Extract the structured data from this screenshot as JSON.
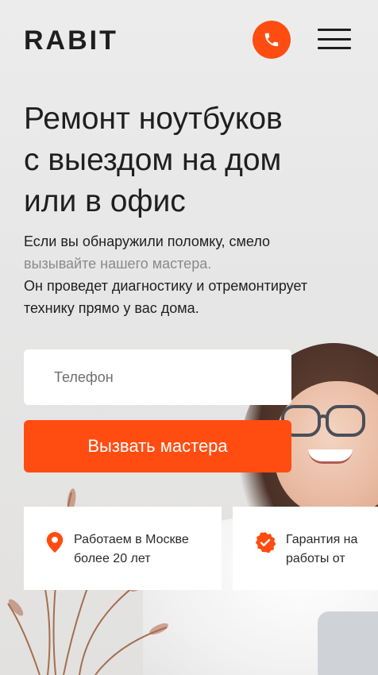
{
  "brand": {
    "logo": "RABIT",
    "accent": "#ff4d12"
  },
  "header": {
    "phone_icon": "phone-icon",
    "menu_icon": "hamburger-menu-icon"
  },
  "hero": {
    "title_lines": [
      "Ремонт ноутбуков",
      "с выездом на дом",
      "или в офис"
    ],
    "desc_line1": "Если вы обнаружили поломку, смело",
    "desc_line2": "вызывайте нашего мастера.",
    "desc_line3": "Он проведет диагностику и отремонтирует",
    "desc_line4": "технику прямо у вас дома."
  },
  "form": {
    "phone_placeholder": "Телефон",
    "phone_value": "",
    "submit_label": "Вызвать мастера"
  },
  "features": [
    {
      "icon": "map-pin-icon",
      "line1": "Работаем в Москве",
      "line2": "более 20 лет"
    },
    {
      "icon": "guarantee-badge-icon",
      "line1": "Гарантия на",
      "line2": "работы от"
    }
  ]
}
